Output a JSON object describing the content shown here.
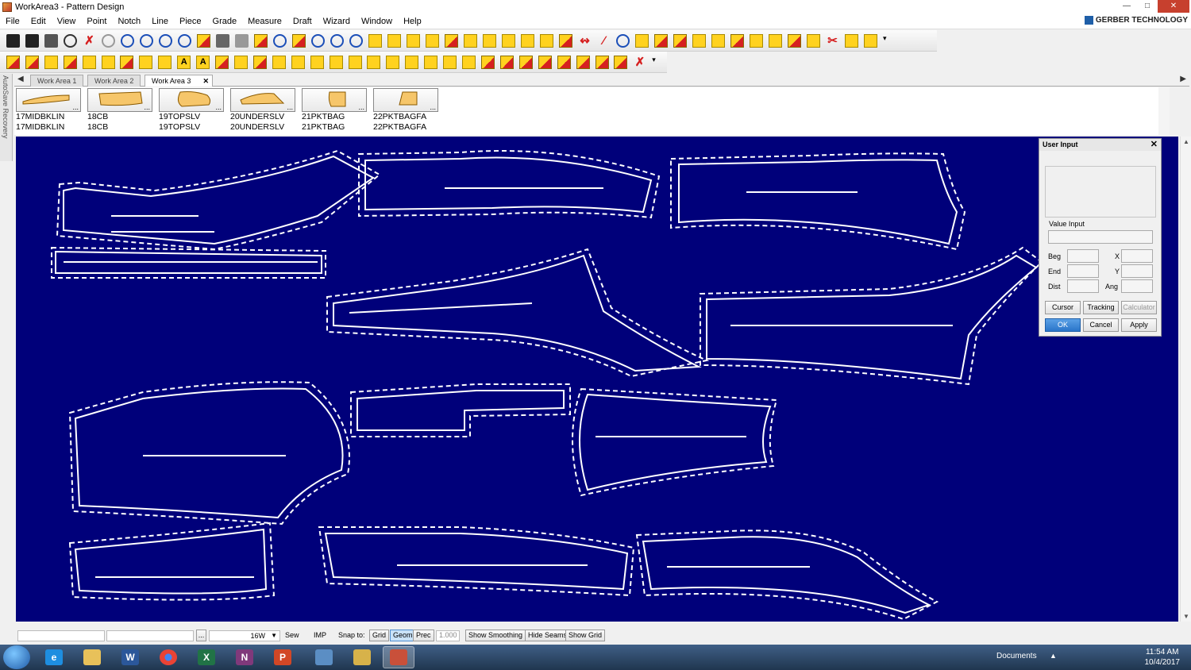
{
  "window": {
    "title": "WorkArea3 - Pattern Design"
  },
  "brand": {
    "name": "GERBER TECHNOLOGY"
  },
  "menu": [
    "File",
    "Edit",
    "View",
    "Point",
    "Notch",
    "Line",
    "Piece",
    "Grade",
    "Measure",
    "Draft",
    "Wizard",
    "Window",
    "Help"
  ],
  "sidebar": {
    "label": "AutoSave Recovery"
  },
  "tabs": [
    "Work Area 1",
    "Work Area 2",
    "Work Area 3"
  ],
  "pieces": [
    {
      "name1": "17MIDBKLIN",
      "name2": "17MIDBKLIN"
    },
    {
      "name1": "18CB",
      "name2": "18CB"
    },
    {
      "name1": "19TOPSLV",
      "name2": "19TOPSLV"
    },
    {
      "name1": "20UNDERSLV",
      "name2": "20UNDERSLV"
    },
    {
      "name1": "21PKTBAG",
      "name2": "21PKTBAG"
    },
    {
      "name1": "22PKTBAGFA",
      "name2": "22PKTBAGFA"
    }
  ],
  "piece_more": "...",
  "dialog": {
    "title": "User Input",
    "value_input_label": "Value Input",
    "beg": "Beg",
    "end": "End",
    "dist": "Dist",
    "x": "X",
    "y": "Y",
    "ang": "Ang",
    "cursor": "Cursor",
    "tracking": "Tracking",
    "calculator": "Calculator",
    "ok": "OK",
    "cancel": "Cancel",
    "apply": "Apply"
  },
  "status": {
    "more": "...",
    "size": "16W",
    "sew": "Sew",
    "imp": "IMP",
    "snap_to": "Snap to:",
    "grid": "Grid",
    "geom": "Geom",
    "prec": "Prec",
    "value": "1.000",
    "show_smoothing": "Show Smoothing",
    "hide_seams": "Hide Seams",
    "show_grid": "Show Grid"
  },
  "taskbar": {
    "documents": "Documents",
    "time": "11:54 AM",
    "date": "10/4/2017"
  },
  "colors": {
    "canvas": "#00007a",
    "pattern_lines": "#ffffff",
    "piece_fill": "#f6c66a"
  }
}
